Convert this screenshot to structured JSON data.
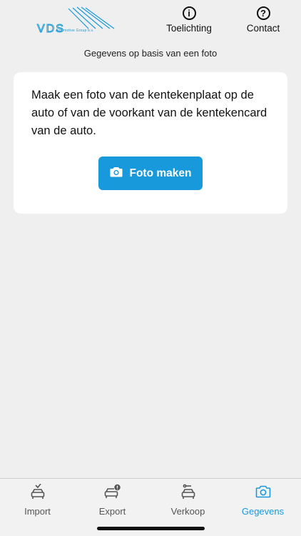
{
  "header": {
    "logo_text": "VDS",
    "logo_sub": "Automotive Group b.v.",
    "help_label": "Toelichting",
    "contact_label": "Contact",
    "help_glyph": "i",
    "contact_glyph": "?"
  },
  "subtitle": "Gegevens op basis van een foto",
  "card": {
    "instruction": "Maak een foto van de kentekenplaat op de auto of van de voorkant van de kentekencard van de auto.",
    "button_label": "Foto maken",
    "button_icon": "camera-icon"
  },
  "tabs": [
    {
      "label": "Import",
      "icon": "car-import-icon",
      "active": false
    },
    {
      "label": "Export",
      "icon": "car-export-icon",
      "active": false
    },
    {
      "label": "Verkoop",
      "icon": "car-sale-icon",
      "active": false
    },
    {
      "label": "Gegevens",
      "icon": "camera-icon",
      "active": true
    }
  ],
  "colors": {
    "accent": "#1799db",
    "background": "#efefef",
    "card": "#ffffff"
  }
}
